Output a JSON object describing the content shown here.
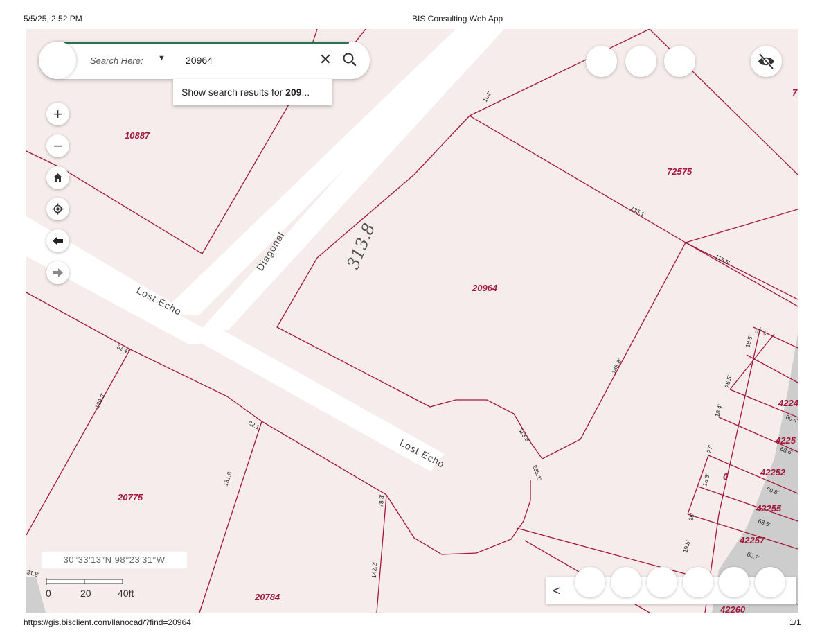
{
  "print": {
    "datetime": "5/5/25, 2:52 PM",
    "page_title": "BIS Consulting Web App",
    "url": "https://gis.bisclient.com/llanocad/?find=20964",
    "page_count": "1/1"
  },
  "search": {
    "label": "Search Here:",
    "value": "20964",
    "suggestion_prefix": "Show search results for ",
    "suggestion_bold": "209",
    "suggestion_suffix": "..."
  },
  "controls": {
    "zoom_in": "+",
    "zoom_out": "−"
  },
  "map": {
    "coordinates": "30°33′13″N 98°23′31″W",
    "scale_labels": [
      "0",
      "20",
      "40ft"
    ],
    "parcels": [
      "10887",
      "72575",
      "20964",
      "20775",
      "20784",
      "42252",
      "42255",
      "42257",
      "42260",
      "4224",
      "4225",
      "0",
      "7"
    ],
    "roads": [
      "Diagonal",
      "Lost Echo",
      "Lost Echo"
    ],
    "dimensions": [
      "104'",
      "135.1'",
      "115.5'",
      "148.8'",
      "313.8'",
      "235.1'",
      "81.4'",
      "129.3'",
      "82.1'",
      "131.8'",
      "78.3'",
      "142.2'",
      "87.1'",
      "18.5'",
      "26.5'",
      "18.4'",
      "27'",
      "18.3'",
      "26'",
      "19.5'",
      "60.4'",
      "68.6'",
      "60.8'",
      "68.5'",
      "60.7'",
      "31.8'"
    ],
    "annotation": "313.8"
  },
  "bottom_nav": {
    "prev": "<"
  }
}
